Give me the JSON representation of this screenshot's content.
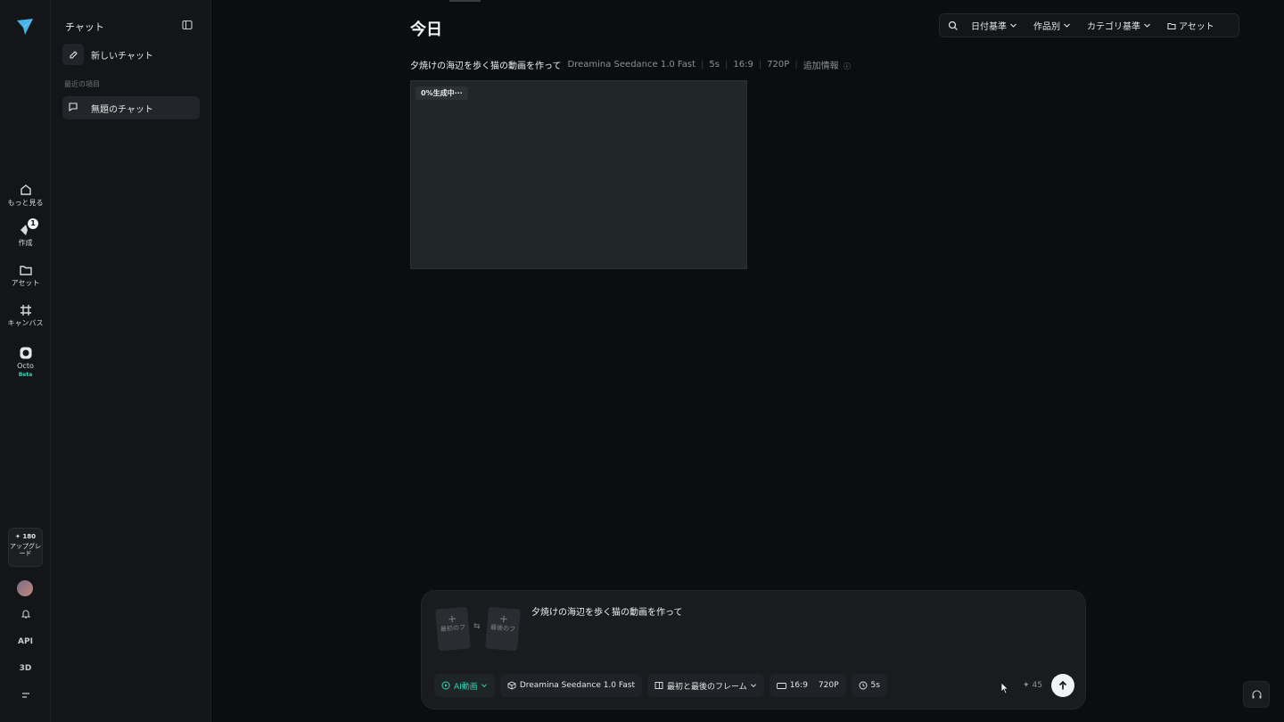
{
  "rail": {
    "logo_icon": "arrow-logo-icon",
    "items": [
      {
        "label": "もっと見る",
        "icon": "home-icon"
      },
      {
        "label": "作成",
        "icon": "create-icon",
        "badge": "1"
      },
      {
        "label": "アセット",
        "icon": "folder-icon"
      },
      {
        "label": "キャンバス",
        "icon": "canvas-icon"
      },
      {
        "label": "Octo",
        "icon": "octo-icon",
        "tag": "Beta"
      }
    ],
    "upgrade": {
      "credits": "180",
      "label": "アップグレード"
    },
    "bottom": {
      "api": "API",
      "three_d": "3D"
    }
  },
  "sidebar": {
    "title": "チャット",
    "new_chat": "新しいチャット",
    "recent_label": "最近の項目",
    "chats": [
      {
        "label": "無題のチャット"
      }
    ]
  },
  "main": {
    "heading": "今日",
    "filters": [
      {
        "label": "日付基準"
      },
      {
        "label": "作品別"
      },
      {
        "label": "カテゴリ基準"
      },
      {
        "label": "アセット"
      }
    ],
    "generation": {
      "prompt": "夕焼けの海辺を歩く猫の動画を作って",
      "model": "Dreamina Seedance 1.0 Fast",
      "duration": "5s",
      "ratio": "16:9",
      "resolution": "720P",
      "more_info": "追加情報",
      "progress_label": "0%生成中···",
      "progress": 0
    }
  },
  "composer": {
    "first_frame": "最初のフ",
    "last_frame": "最後のフ",
    "prompt": "夕焼けの海辺を歩く猫の動画を作って",
    "mode": "AI動画",
    "model": "Dreamina Seedance 1.0 Fast",
    "frame_mode": "最初と最後のフレーム",
    "ratio": "16:9",
    "resolution": "720P",
    "duration": "5s",
    "cost": "45"
  },
  "colors": {
    "accent": "#2fd6b5",
    "background": "#0c0d0f",
    "panel": "#141518"
  }
}
